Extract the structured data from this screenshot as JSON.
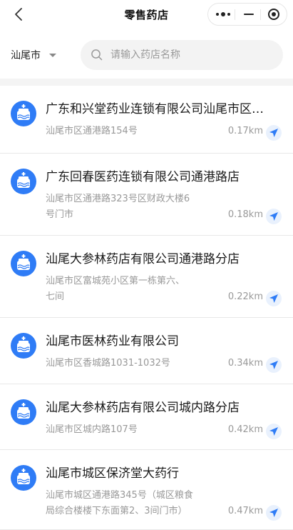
{
  "header": {
    "title": "零售药店"
  },
  "filter": {
    "city": "汕尾市",
    "search_placeholder": "请输入药店名称"
  },
  "colors": {
    "accent": "#2f7cf6",
    "nav_button_bg": "#e9f1fd",
    "muted_text": "#999999"
  },
  "stores": [
    {
      "name": "广东和兴堂药业连锁有限公司汕尾市区…",
      "address": [
        "汕尾市区通港路154号"
      ],
      "distance": "0.17km"
    },
    {
      "name": "广东回春医药连锁有限公司通港路店",
      "address": [
        "汕尾市区通港路323号区财政大楼6",
        "号门市"
      ],
      "distance": "0.18km"
    },
    {
      "name": "汕尾大参林药店有限公司通港路分店",
      "address": [
        "汕尾市区富城苑小区第一栋第六、",
        "七间"
      ],
      "distance": "0.22km"
    },
    {
      "name": "汕尾市医林药业有限公司",
      "address": [
        "汕尾市区香城路1031-1032号"
      ],
      "distance": "0.34km"
    },
    {
      "name": "汕尾大参林药店有限公司城内路分店",
      "address": [
        "汕尾市区城内路107号"
      ],
      "distance": "0.42km"
    },
    {
      "name": "汕尾市城区保济堂大药行",
      "address": [
        "汕尾市城区通港路345号（城区粮食",
        "局综合楼楼下东面第2、3间门市）"
      ],
      "distance": "0.47km"
    }
  ]
}
